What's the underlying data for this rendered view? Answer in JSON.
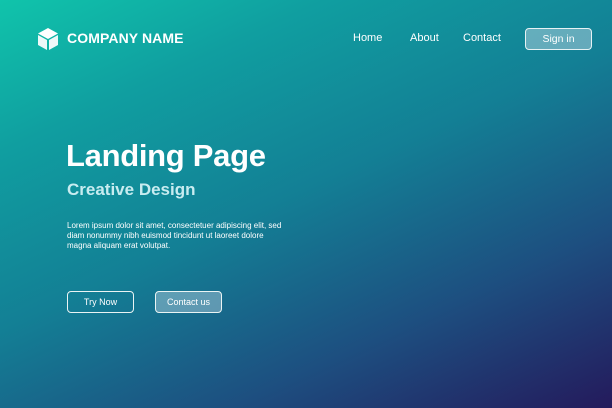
{
  "brand": {
    "logo_icon": "cube-icon",
    "name": "COMPANY NAME"
  },
  "nav": {
    "items": [
      {
        "label": "Home"
      },
      {
        "label": "About"
      },
      {
        "label": "Contact"
      }
    ],
    "sign_in_label": "Sign in"
  },
  "hero": {
    "title": "Landing Page",
    "subtitle": "Creative Design",
    "body_lines": [
      "Lorem ipsum dolor sit amet, consectetuer adipiscing elit, sed",
      "diam nonummy nibh euismod tincidunt ut laoreet dolore",
      "magna aliquam erat volutpat."
    ],
    "primary_button": "Try Now",
    "secondary_button": "Contact us"
  },
  "colors": {
    "gradient_start": "#10c4ab",
    "gradient_end": "#241a5c",
    "subtitle": "#c8ecf0"
  }
}
